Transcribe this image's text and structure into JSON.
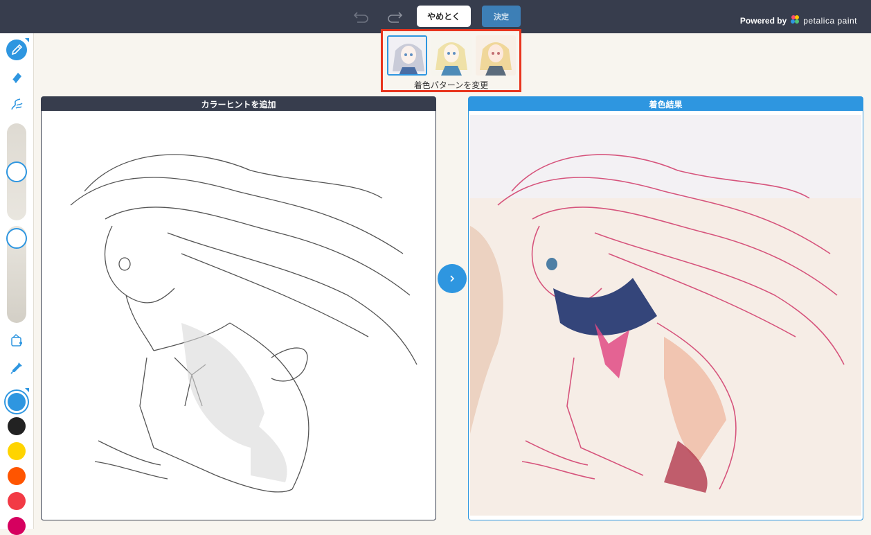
{
  "toolbar": {
    "cancel_label": "やめとく",
    "confirm_label": "決定",
    "undo_icon": "undo-icon",
    "redo_icon": "redo-icon"
  },
  "branding": {
    "powered_by": "Powered by",
    "brand_name": "petalica paint"
  },
  "sidebar": {
    "tools": [
      "pencil-icon",
      "eraser-icon",
      "brush-icon",
      "paint-bucket-icon",
      "eyedropper-icon"
    ],
    "palette": [
      "#2e96e0",
      "#222222",
      "#ffd400",
      "#ff5500",
      "#f23a45",
      "#d6005f"
    ],
    "selected_color": "#2e96e0"
  },
  "patterns": {
    "label": "着色パターンを変更",
    "thumbnails": [
      "pattern-1",
      "pattern-2",
      "pattern-3"
    ],
    "active_index": 0
  },
  "panels": {
    "left_title": "カラーヒントを追加",
    "right_title": "着色結果"
  },
  "colors": {
    "topbar": "#373d4d",
    "accent": "#2e96e0",
    "highlight": "#e8351e"
  }
}
